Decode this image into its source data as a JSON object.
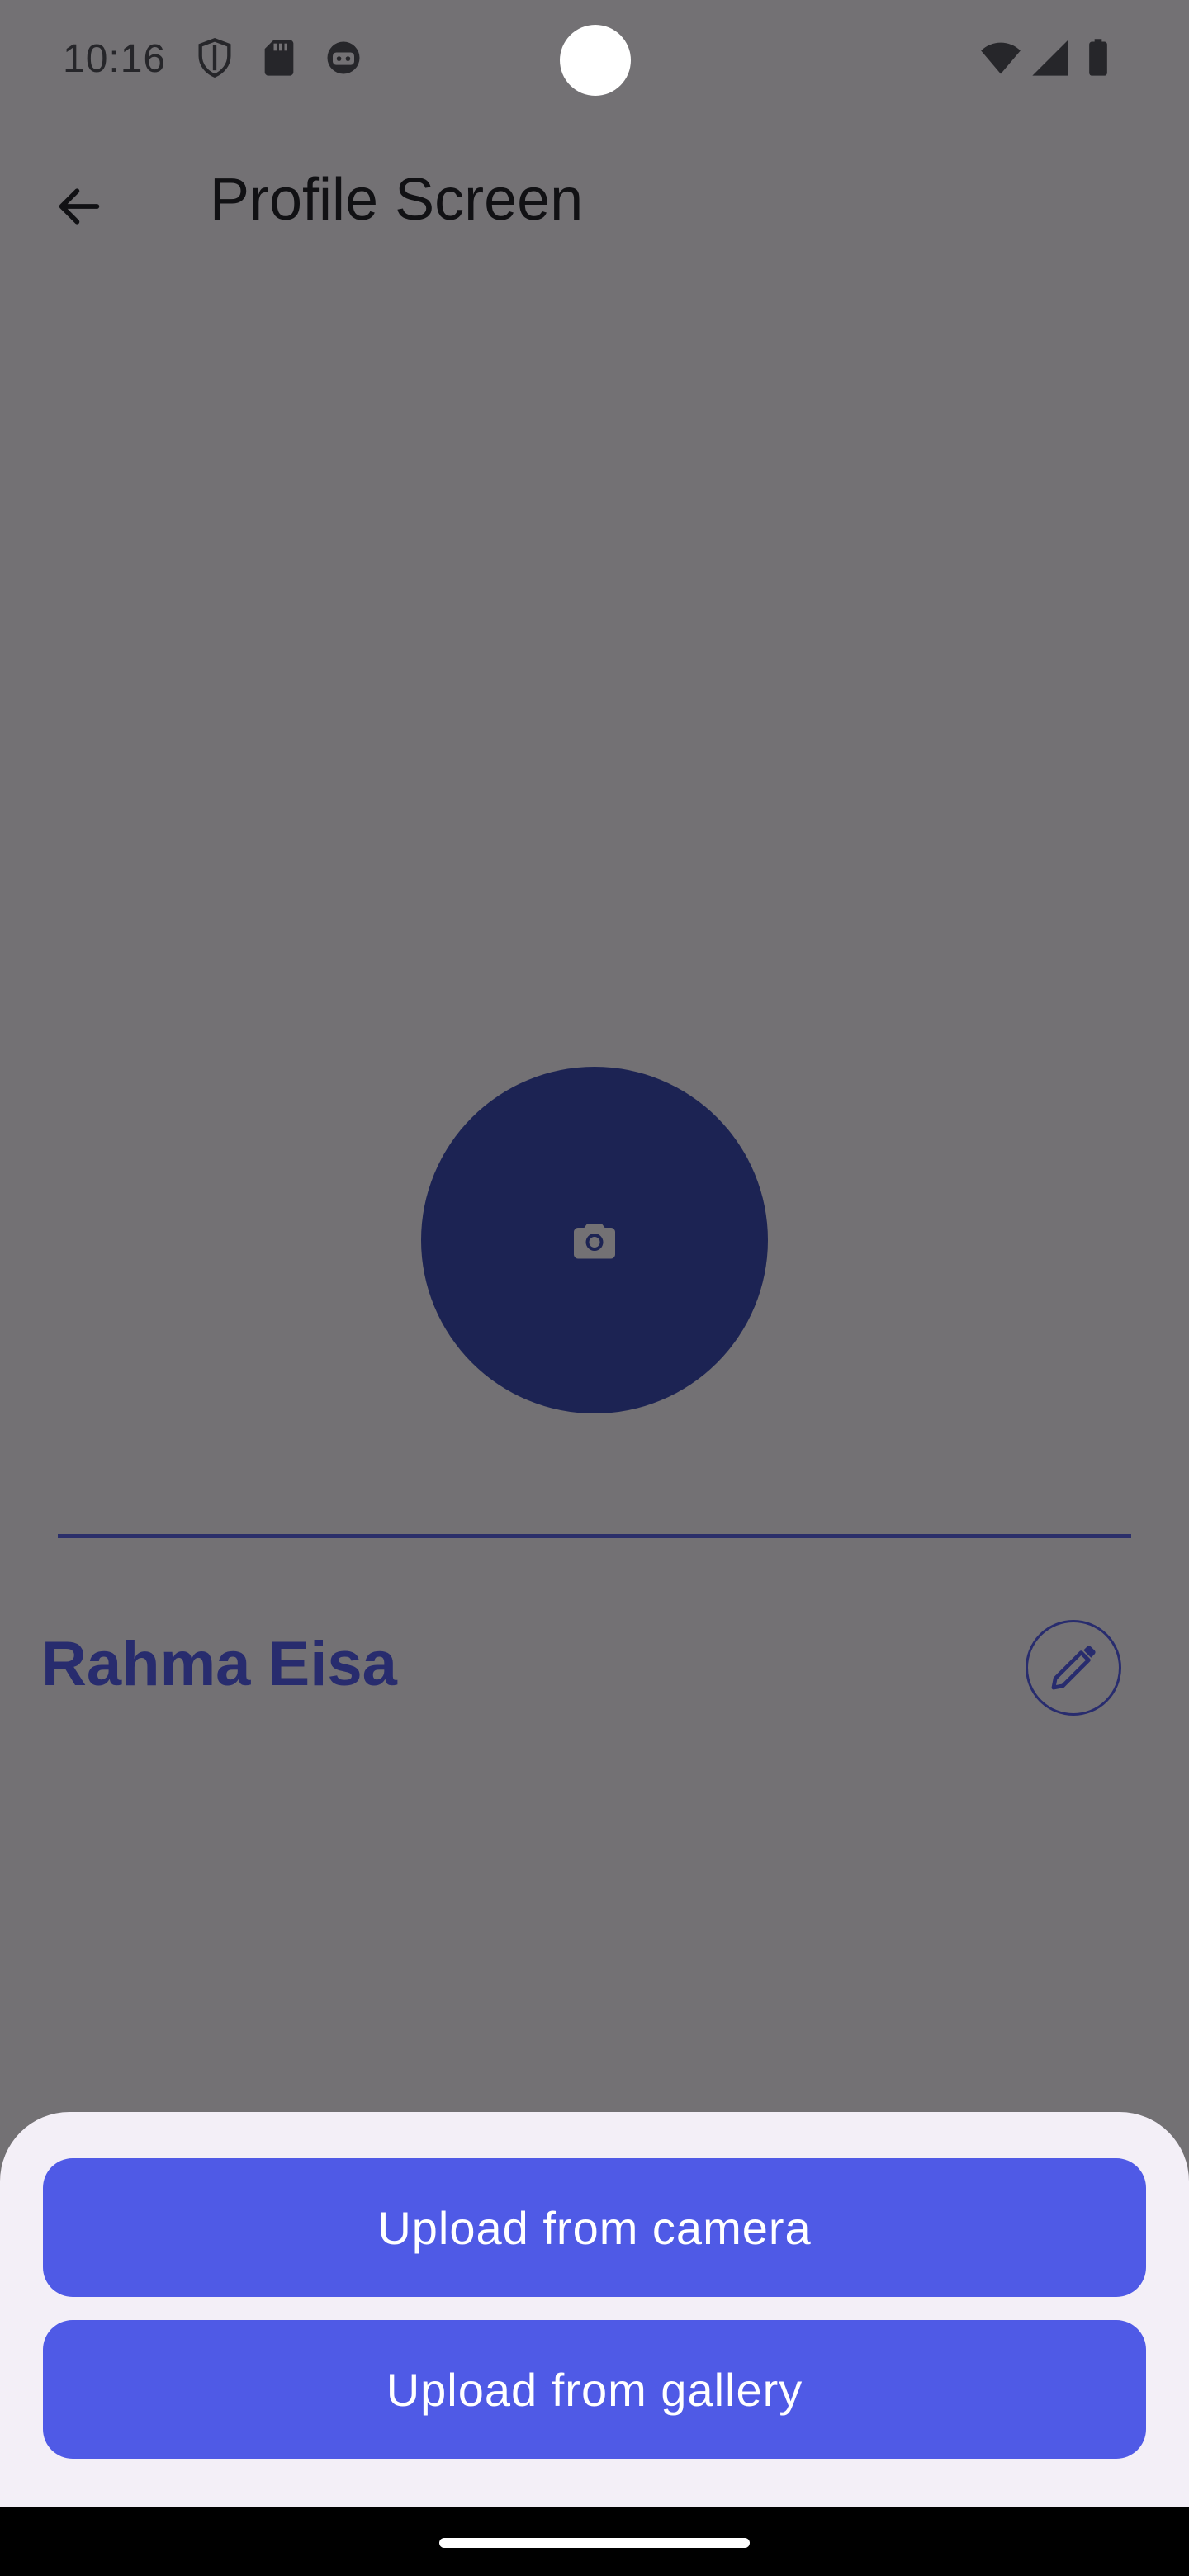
{
  "status_bar": {
    "time": "10:16",
    "left_icons": [
      "shield-icon",
      "sd-card-icon",
      "android-icon"
    ],
    "right_icons": [
      "wifi-icon",
      "signal-icon",
      "battery-icon"
    ]
  },
  "app_bar": {
    "back_icon": "arrow-back-icon",
    "title": "Profile Screen"
  },
  "profile": {
    "avatar_icon": "camera-icon",
    "name": "Rahma Eisa",
    "edit_icon": "pencil-icon"
  },
  "bottom_sheet": {
    "camera_button_label": "Upload from camera",
    "gallery_button_label": "Upload from gallery"
  },
  "colors": {
    "scrim_background": "#737174",
    "accent_dark": "#1c2353",
    "name_text": "#282c6e",
    "sheet_background": "#f3eff7",
    "button_background": "#4f5ae6"
  }
}
